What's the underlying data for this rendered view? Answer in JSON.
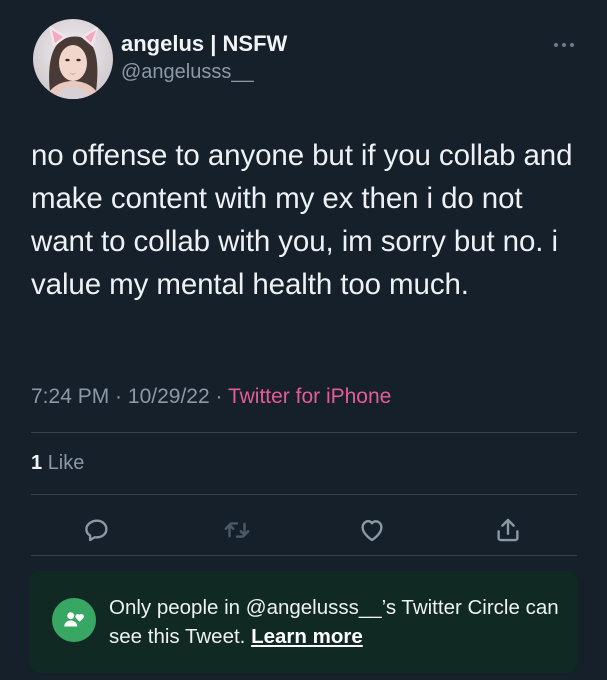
{
  "author": {
    "name": "angelus | NSFW",
    "handle": "@angelusss__"
  },
  "tweet": {
    "text": "no offense to anyone but if you collab and make content with my ex then i do not want to collab with you, im sorry but no. i value my mental health too much.",
    "time": "7:24 PM",
    "date": "10/29/22",
    "separator": " · ",
    "source": "Twitter for iPhone"
  },
  "stats": {
    "like_count": "1",
    "like_label": "Like"
  },
  "actions": {
    "icons": [
      "reply-icon",
      "retweet-icon",
      "like-icon",
      "share-icon"
    ]
  },
  "circle_notice": {
    "text": "Only people in @angelusss__’s Twitter Circle can see this Tweet.",
    "link": "Learn more"
  },
  "colors": {
    "background": "#15202b",
    "source_link": "#e35c97",
    "circle_bg": "#102a23",
    "circle_icon": "#38a764",
    "muted": "#8b98a5"
  }
}
